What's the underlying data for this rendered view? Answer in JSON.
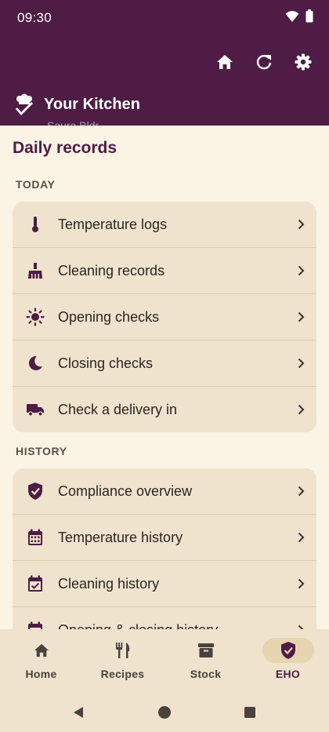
{
  "status": {
    "time": "09:30"
  },
  "header": {
    "title": "Your Kitchen",
    "partial_text": "Saura Bldr"
  },
  "page": {
    "title": "Daily records"
  },
  "sections": {
    "today": {
      "label": "TODAY",
      "items": [
        {
          "label": "Temperature logs",
          "icon": "thermometer-icon"
        },
        {
          "label": "Cleaning records",
          "icon": "broom-icon"
        },
        {
          "label": "Opening checks",
          "icon": "sun-icon"
        },
        {
          "label": "Closing checks",
          "icon": "moon-icon"
        },
        {
          "label": "Check a delivery in",
          "icon": "truck-icon"
        }
      ]
    },
    "history": {
      "label": "HISTORY",
      "items": [
        {
          "label": "Compliance overview",
          "icon": "shield-check-icon"
        },
        {
          "label": "Temperature history",
          "icon": "calendar-grid-icon"
        },
        {
          "label": "Cleaning history",
          "icon": "calendar-check-icon"
        },
        {
          "label": "Opening & closing history",
          "icon": "calendar-list-icon"
        }
      ]
    }
  },
  "nav": [
    {
      "label": "Home",
      "icon": "home-icon",
      "active": false
    },
    {
      "label": "Recipes",
      "icon": "cutlery-icon",
      "active": false
    },
    {
      "label": "Stock",
      "icon": "archive-box-icon",
      "active": false
    },
    {
      "label": "EHO",
      "icon": "shield-check-icon",
      "active": true
    }
  ],
  "colors": {
    "primary": "#4e1c44",
    "background": "#fbf3e4",
    "card": "#efe3ce",
    "active_pill": "#e6d5b0"
  }
}
